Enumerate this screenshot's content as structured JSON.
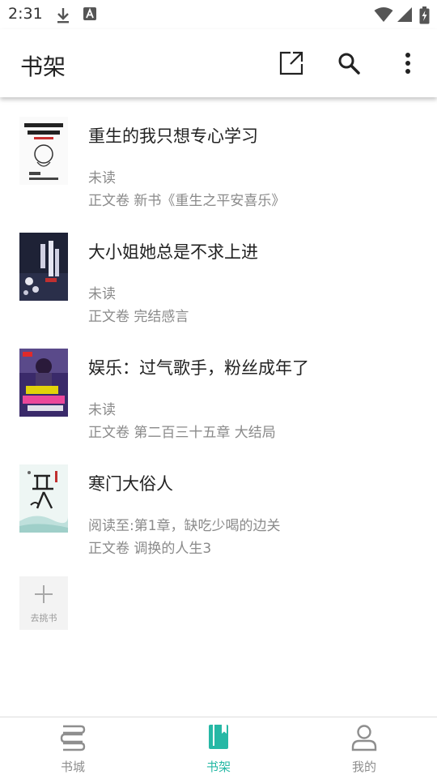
{
  "status_bar": {
    "time": "2:31",
    "icons": [
      "download-icon",
      "a-box-icon",
      "wifi-icon",
      "cellular-icon",
      "battery-icon"
    ]
  },
  "app_bar": {
    "title": "书架",
    "actions": [
      "share-icon",
      "search-icon",
      "more-vert-icon"
    ]
  },
  "books": [
    {
      "title": "重生的我只想专心学习",
      "progress": "未读",
      "latest": "正文卷 新书《重生之平安喜乐》",
      "cover_icon": "book-cover"
    },
    {
      "title": "大小姐她总是不求上进",
      "progress": "未读",
      "latest": "正文卷 完结感言",
      "cover_icon": "book-cover"
    },
    {
      "title": "娱乐：过气歌手，粉丝成年了",
      "progress": "未读",
      "latest": "正文卷 第二百三十五章 大结局",
      "cover_icon": "book-cover"
    },
    {
      "title": "寒门大俗人",
      "progress": "阅读至:第1章，缺吃少喝的边关",
      "latest": "正文卷 调换的人生3",
      "cover_icon": "book-cover"
    }
  ],
  "add_book": {
    "label": "去挑书",
    "icon": "plus-icon"
  },
  "bottom_nav": {
    "items": [
      {
        "label": "书城",
        "icon": "bookstore-icon",
        "active": false
      },
      {
        "label": "书架",
        "icon": "bookshelf-icon",
        "active": true
      },
      {
        "label": "我的",
        "icon": "person-icon",
        "active": false
      }
    ]
  },
  "colors": {
    "accent": "#26b8a5",
    "secondary_text": "#8a8a8a",
    "primary_text": "#222222"
  }
}
